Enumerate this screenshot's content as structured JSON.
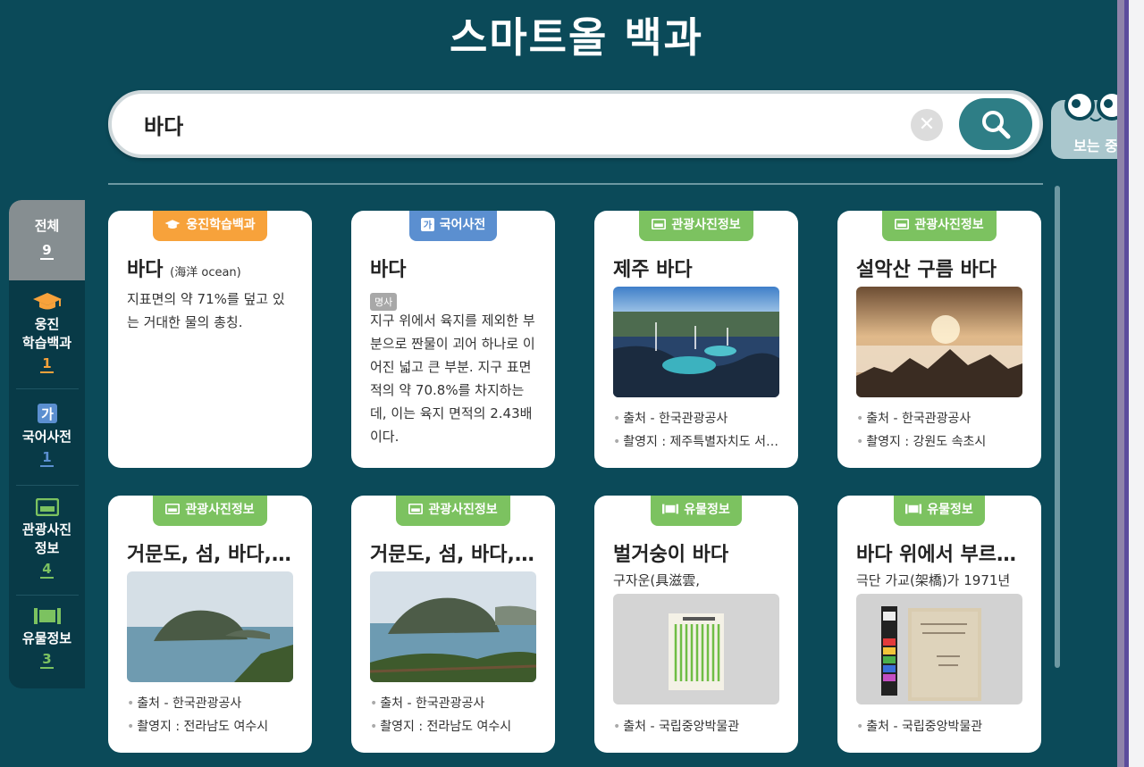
{
  "app": {
    "title": "스마트올 백과"
  },
  "search": {
    "value": "바다",
    "placeholder": ""
  },
  "viewing": {
    "label": "보는 중"
  },
  "categories": [
    {
      "label": "전체",
      "count": "9",
      "count_color": "#ffffff"
    },
    {
      "label": "웅진 학습백과",
      "line1": "웅진",
      "line2": "학습백과",
      "count": "1",
      "icon": "graduation-cap-icon",
      "count_color": "#f7a23b"
    },
    {
      "label": "국어사전",
      "count": "1",
      "icon": "ga-dictionary-icon",
      "count_color": "#5b8fd0"
    },
    {
      "label": "관광사진 정보",
      "line1": "관광사진",
      "line2": "정보",
      "count": "4",
      "icon": "photo-card-icon",
      "count_color": "#7cc260"
    },
    {
      "label": "유물정보",
      "count": "3",
      "icon": "film-relic-icon",
      "count_color": "#7cc260"
    }
  ],
  "cards": [
    {
      "badge": "웅진학습백과",
      "badge_icon": "graduation-cap-icon",
      "badge_color": "#f7a23b",
      "title": "바다",
      "hanja": "(海洋 ocean)",
      "desc": "지표면의 약 71%를 덮고 있는 거대한 물의 총칭."
    },
    {
      "badge": "국어사전",
      "badge_icon": "ga-dictionary-icon",
      "badge_color": "#5b8fd0",
      "title": "바다",
      "pos": "명사",
      "desc": "지구 위에서 육지를 제외한 부분으로 짠물이 괴어 하나로 이어진 넓고 큰 부분. 지구 표면적의 약 70.8%를 차지하는데, 이는 육지 면적의 2.43배이다."
    },
    {
      "badge": "관광사진정보",
      "badge_icon": "photo-card-icon",
      "badge_color": "#7cc260",
      "title": "제주 바다",
      "photo": "jeju-coast-photo",
      "source": "출처 - 한국관광공사",
      "location": "촬영지 : 제주특별자치도 서귀포시"
    },
    {
      "badge": "관광사진정보",
      "badge_icon": "photo-card-icon",
      "badge_color": "#7cc260",
      "title": "설악산 구름 바다",
      "photo": "seoraksan-clouds-photo",
      "source": "출처 - 한국관광공사",
      "location": "촬영지 : 강원도 속초시"
    },
    {
      "badge": "관광사진정보",
      "badge_icon": "photo-card-icon",
      "badge_color": "#7cc260",
      "title": "거문도, 섬, 바다, 해안",
      "photo": "geomundo-island-photo",
      "source": "출처 - 한국관광공사",
      "location": "촬영지 : 전라남도 여수시"
    },
    {
      "badge": "관광사진정보",
      "badge_icon": "photo-card-icon",
      "badge_color": "#7cc260",
      "title": "거문도, 섬, 바다, 해안",
      "photo": "geomundo-island-photo",
      "source": "출처 - 한국관광공사",
      "location": "촬영지 : 전라남도 여수시"
    },
    {
      "badge": "유물정보",
      "badge_icon": "film-relic-icon",
      "badge_color": "#7cc260",
      "title": "벌거숭이 바다",
      "subtitle": "구자운(具滋雲,",
      "photo": "book-cover-photo",
      "source": "출처 - 국립중앙박물관"
    },
    {
      "badge": "유물정보",
      "badge_icon": "film-relic-icon",
      "badge_color": "#7cc260",
      "title": "바다 위에서 부르는 노래",
      "subtitle": "극단 가교(架橋)가 1971년",
      "photo": "old-document-photo",
      "source": "출처 - 국립중앙박물관"
    }
  ]
}
